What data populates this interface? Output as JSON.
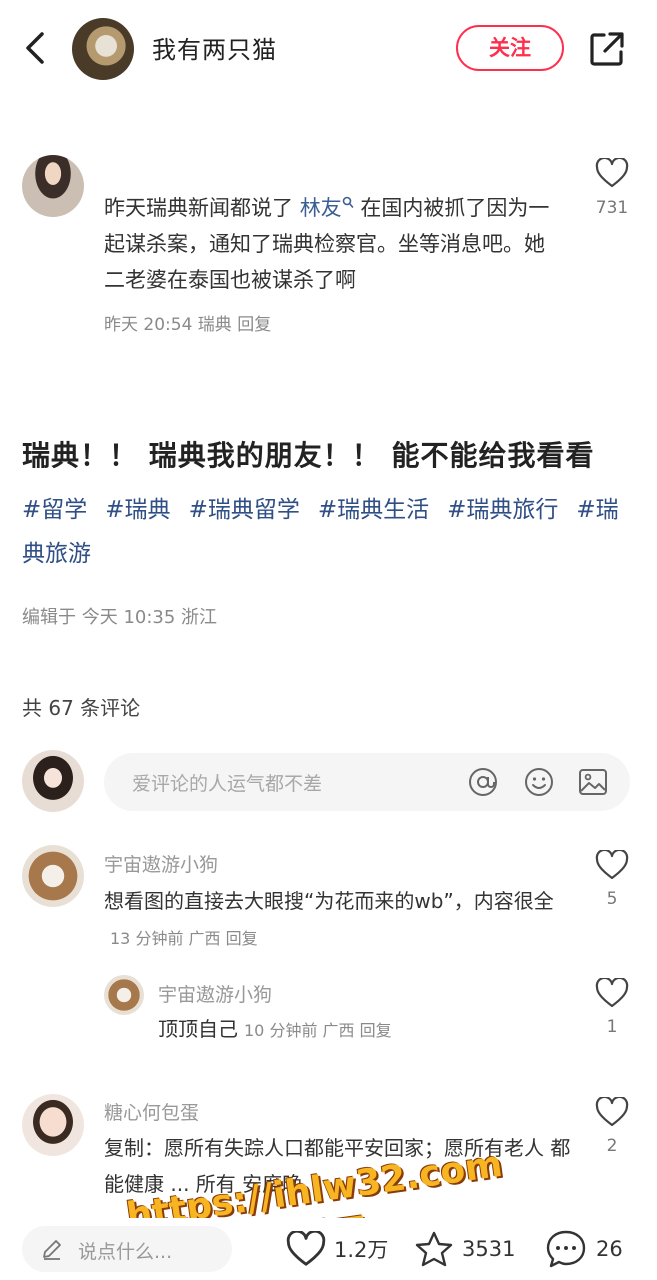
{
  "header": {
    "author_name": "我有两只猫",
    "follow_label": "关注"
  },
  "top_comment": {
    "text_before": "昨天瑞典新闻都说了 ",
    "keyword": "林友",
    "text_after": " 在国内被抓了因为一起谋杀案，通知了瑞典检察官。坐等消息吧。她二老婆在泰国也被谋杀了啊",
    "meta": "昨天 20:54 瑞典 回复",
    "likes": "731"
  },
  "post": {
    "title": "瑞典！！ 瑞典我的朋友！！ 能不能给我看看",
    "tags": [
      "#留学",
      "#瑞典",
      "#瑞典留学",
      "#瑞典生活",
      "#瑞典旅行",
      "#瑞典旅游"
    ],
    "edited": "编辑于 今天 10:35 浙江",
    "comment_count": "共 67 条评论"
  },
  "comment_input": {
    "placeholder": "爱评论的人运气都不差"
  },
  "comments": [
    {
      "name": "宇宙遨游小狗",
      "text": "想看图的直接去大眼搜“为花而来的wb”，内容很全",
      "meta": "13 分钟前 广西 回复",
      "likes": "5"
    },
    {
      "name": "宇宙遨游小狗",
      "text": "顶顶自己",
      "meta": "10 分钟前 广西 回复",
      "likes": "1"
    },
    {
      "name": "糖心何包蛋",
      "text": "复制：愿所有失踪人口都能平安回家；愿所有老人 都能健康 ... 所有 安度晚",
      "likes": "2"
    }
  ],
  "watermark": {
    "line1": "https://ihlw32.com",
    "line2": "黑料网"
  },
  "bottom_bar": {
    "say_placeholder": "说点什么...",
    "likes": "1.2万",
    "stars": "3531",
    "comments": "26"
  },
  "colors": {
    "accent": "#ff2e4d",
    "link": "#2f4f86"
  }
}
